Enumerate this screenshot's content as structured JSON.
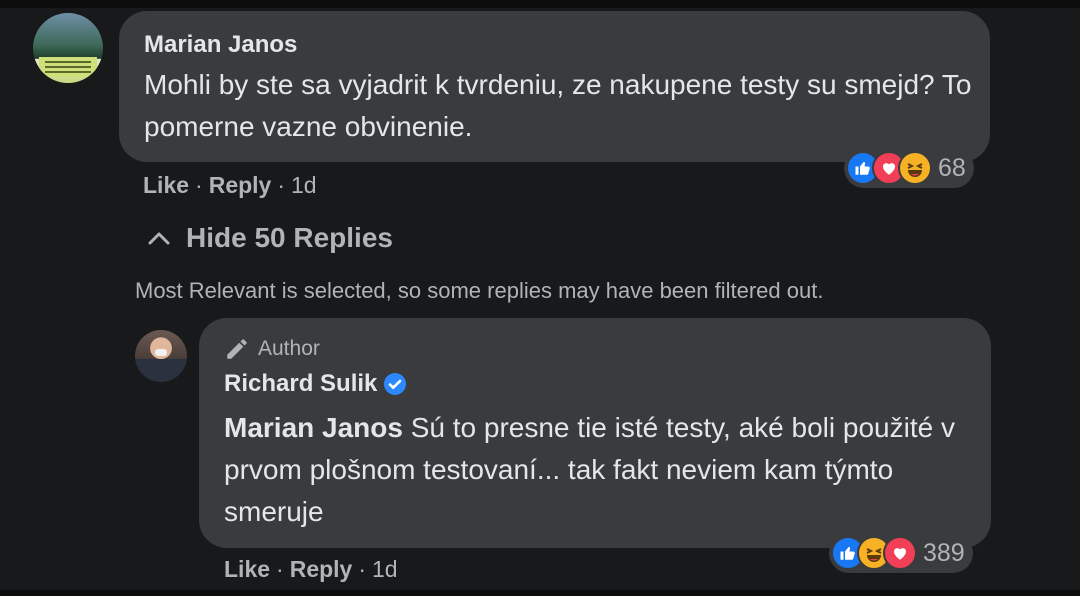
{
  "comment": {
    "author": "Marian Janos",
    "text": "Mohli by ste sa vyjadrit k tvrdeniu, ze nakupene testy su smejd? To pomerne vazne obvinenie.",
    "actions": {
      "like": "Like",
      "reply": "Reply",
      "time": "1d",
      "separator": "·"
    },
    "reactions": {
      "icons": [
        "like-icon",
        "love-icon",
        "haha-icon"
      ],
      "count": "68"
    }
  },
  "replies_toggle": {
    "label": "Hide 50 Replies",
    "icon": "chevron-up-icon"
  },
  "filter_note": "Most Relevant is selected, so some replies may have been filtered out.",
  "reply": {
    "badge": "Author",
    "author": "Richard Sulik",
    "verified": true,
    "mention": "Marian Janos",
    "text": "Sú to presne tie isté testy, aké boli použité v prvom plošnom testovaní... tak fakt neviem kam týmto smeruje",
    "actions": {
      "like": "Like",
      "reply": "Reply",
      "time": "1d",
      "separator": "·"
    },
    "reactions": {
      "icons": [
        "like-icon",
        "haha-icon",
        "love-icon"
      ],
      "count": "389"
    }
  },
  "colors": {
    "background": "#18191a",
    "bubble": "#3a3b3c",
    "text": "#e4e6eb",
    "secondary_text": "#b0b3b8",
    "verified": "#2d88ff",
    "like": "#1877f2",
    "love": "#f33e58",
    "haha": "#f7b125"
  }
}
